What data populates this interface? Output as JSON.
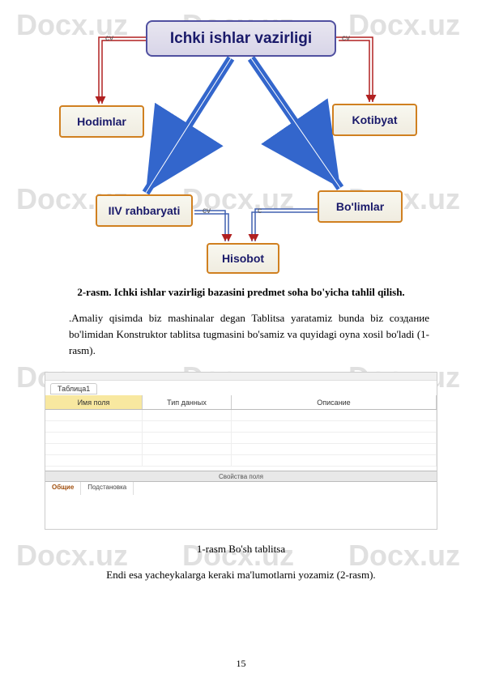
{
  "watermark": "Docx.uz",
  "diagram": {
    "main": "Ichki ishlar vazirligi",
    "hodimlar": "Hodimlar",
    "kotibyat": "Kotibyat",
    "rahbaryati": "IIV rahbaryati",
    "bolimlar": "Bo'limlar",
    "hisobot": "Hisobot",
    "cv": "cv",
    "c": "c"
  },
  "caption1": "2-rasm. Ichki ishlar vazirligi bazasini predmet soha bo'yicha tahlil qilish.",
  "body1": ".Amaliy qisimda biz mashinalar degan Tablitsa yaratamiz bunda biz создание bo'limidan Konstruktor tablitsa tugmasini bo'samiz va quyidagi oyna xosil bo'ladi (1-rasm).",
  "screenshot": {
    "tab": "Таблица1",
    "col1": "Имя поля",
    "col2": "Тип данных",
    "col3": "Описание",
    "splitter": "Свойства поля",
    "btab1": "Общие",
    "btab2": "Подстановка"
  },
  "caption2": "1-rasm Bo'sh tablitsa",
  "body2": "Endi esa yacheykalarga keraki ma'lumotlarni yozamiz (2-rasm).",
  "pageNumber": "15"
}
